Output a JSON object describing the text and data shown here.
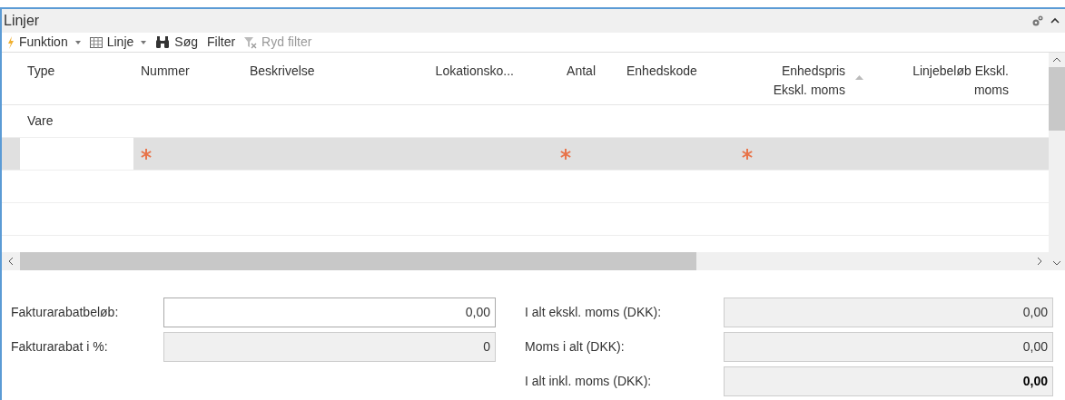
{
  "panel": {
    "title": "Linjer",
    "collapsed": false
  },
  "toolbar": [
    {
      "label": "Funktion",
      "dropdown": true,
      "disabled": false
    },
    {
      "label": "Linje",
      "dropdown": true,
      "disabled": false
    },
    {
      "label": "Søg",
      "dropdown": false,
      "disabled": false
    },
    {
      "label": "Filter",
      "dropdown": false,
      "disabled": false
    },
    {
      "label": "Ryd filter",
      "dropdown": false,
      "disabled": true
    }
  ],
  "table": {
    "columns": [
      {
        "label": "Type"
      },
      {
        "label": "Nummer",
        "required": true
      },
      {
        "label": "Beskrivelse"
      },
      {
        "label": "Lokationsko..."
      },
      {
        "label": "Antal",
        "required": true
      },
      {
        "label": "Enhedskode"
      },
      {
        "label": "Enhedspris Ekskl. moms",
        "required": true,
        "sorted": true
      },
      {
        "label": "Linjebeløb Ekskl. moms"
      }
    ],
    "rows": [
      {
        "kind": "group",
        "type": "Vare",
        "selected": false
      },
      {
        "kind": "new",
        "selected": true
      },
      {
        "kind": "empty",
        "selected": false
      },
      {
        "kind": "empty",
        "selected": false
      }
    ]
  },
  "totals_left": [
    {
      "label": "Fakturarabatbeløb:",
      "value": "0,00",
      "editable": true,
      "bold": false
    },
    {
      "label": "Fakturarabat i %:",
      "value": "0",
      "editable": false,
      "bold": false
    }
  ],
  "totals_right": [
    {
      "label": "I alt ekskl. moms (DKK):",
      "value": "0,00",
      "editable": false,
      "bold": false
    },
    {
      "label": "Moms i alt (DKK):",
      "value": "0,00",
      "editable": false,
      "bold": false
    },
    {
      "label": "I alt inkl. moms (DKK):",
      "value": "0,00",
      "editable": false,
      "bold": true
    }
  ]
}
